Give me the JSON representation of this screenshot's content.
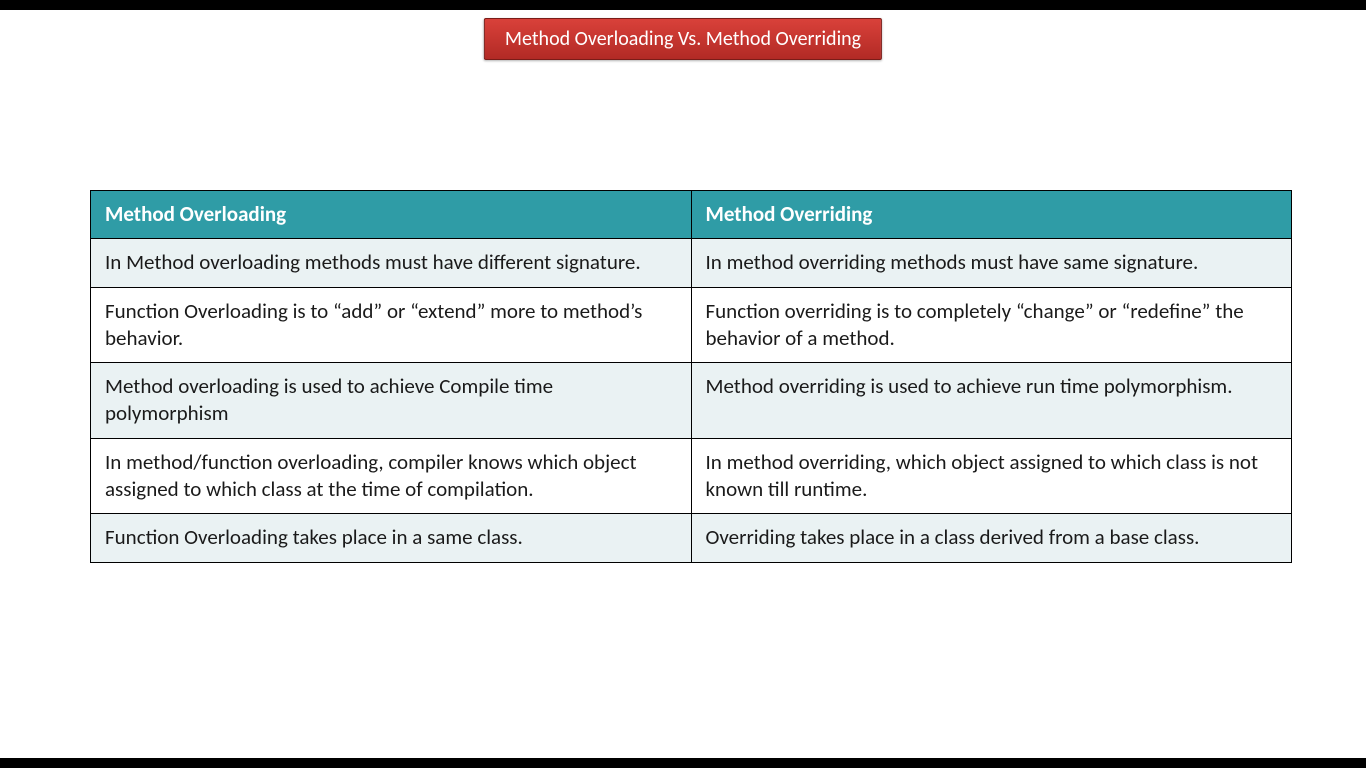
{
  "title": "Method Overloading Vs. Method Overriding",
  "table": {
    "headers": {
      "left": "Method Overloading",
      "right": "Method Overriding"
    },
    "rows": [
      {
        "left": "In Method overloading methods must have different signature.",
        "right": "In method overriding methods must have same signature."
      },
      {
        "left": "Function Overloading is to “add” or “extend” more to method’s behavior.",
        "right": "Function overriding is to completely “change” or “redefine” the behavior of a method."
      },
      {
        "left": "Method overloading is used to achieve Compile time polymorphism",
        "right": "Method overriding is used to achieve run time polymorphism."
      },
      {
        "left": "In method/function overloading, compiler knows which object assigned to which class at the time of compilation.",
        "right": "In method overriding, which object assigned to which class is not known till runtime."
      },
      {
        "left": "Function Overloading takes place in a same class.",
        "right": "Overriding takes place in a class derived from a base class."
      }
    ]
  }
}
